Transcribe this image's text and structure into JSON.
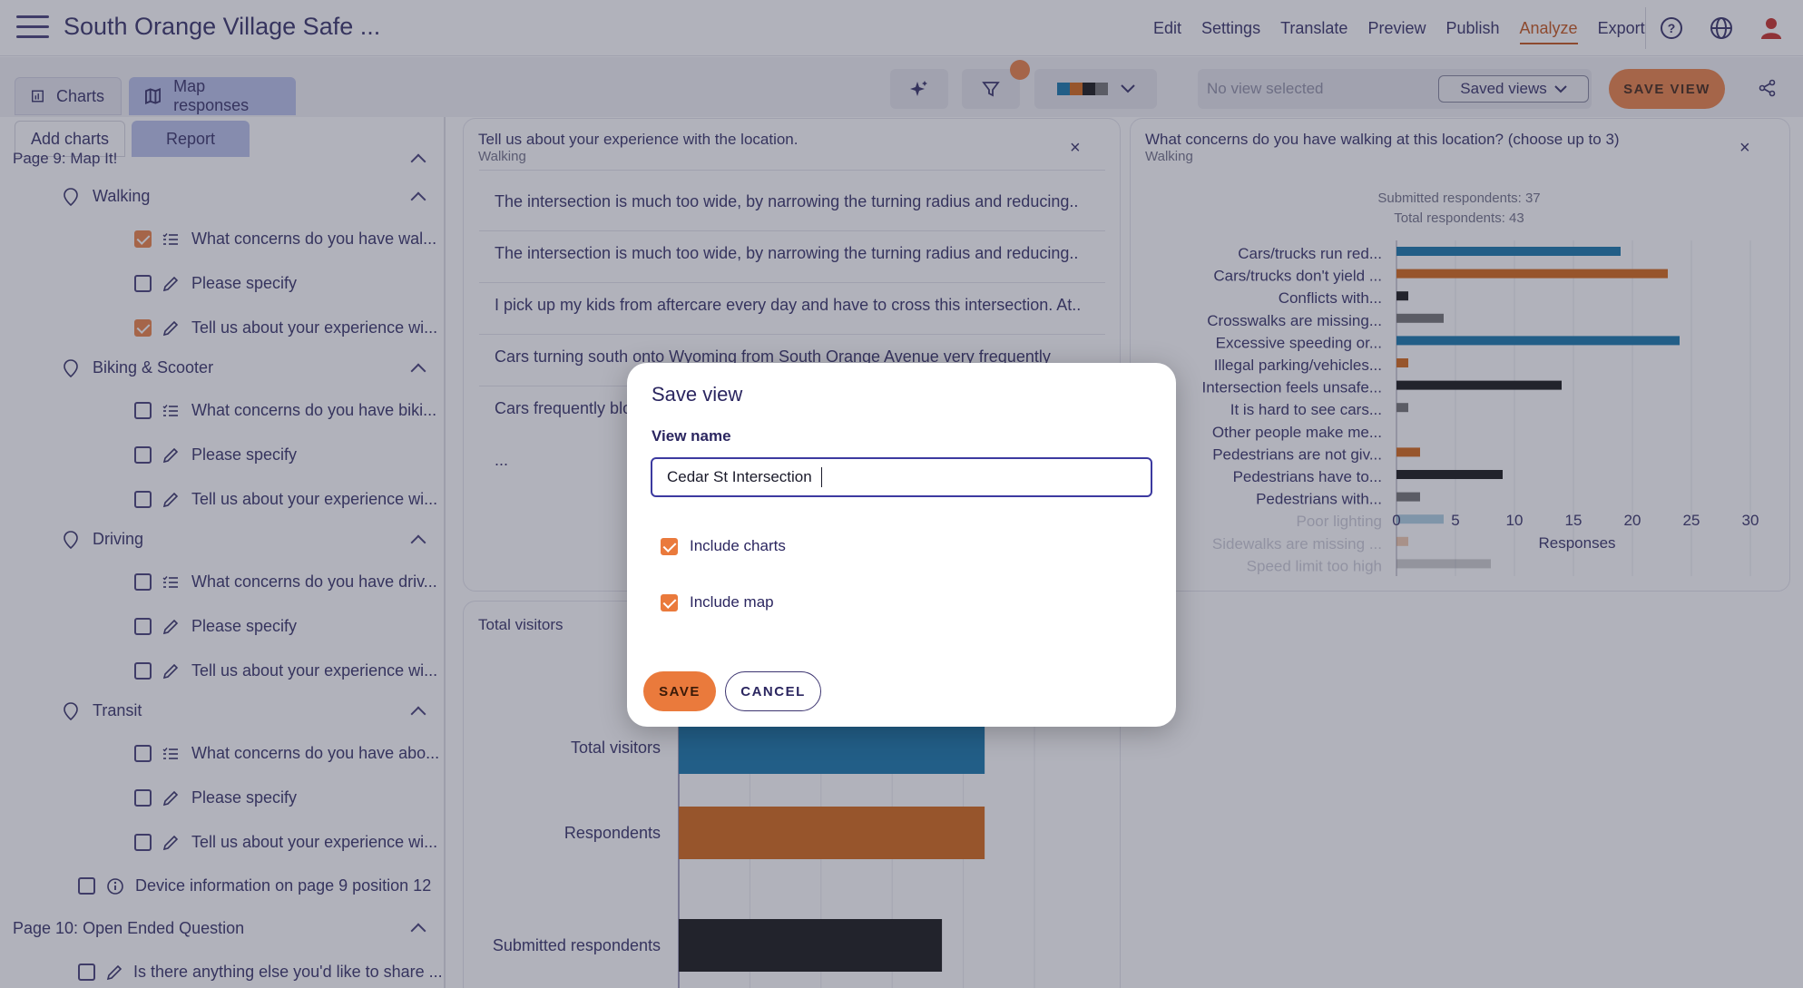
{
  "app": {
    "title": "South Orange Village Safe ..."
  },
  "nav": {
    "items": [
      "Edit",
      "Settings",
      "Translate",
      "Preview",
      "Publish",
      "Analyze",
      "Export"
    ],
    "active": "Analyze"
  },
  "tabs": {
    "charts": "Charts",
    "map": "Map responses"
  },
  "view": {
    "placeholder": "No view selected",
    "saved_views": "Saved views",
    "save_view": "SAVE VIEW"
  },
  "sidebar": {
    "tabs": {
      "add": "Add charts",
      "report": "Report"
    },
    "page9": "Page 9: Map It!",
    "groups": [
      {
        "name": "Walking",
        "items": [
          {
            "text": "What concerns do you have wal...",
            "checked": true,
            "icon": "list-icon"
          },
          {
            "text": "Please specify",
            "checked": false,
            "icon": "pencil-icon"
          },
          {
            "text": "Tell us about your experience wi...",
            "checked": true,
            "icon": "pencil-icon"
          }
        ]
      },
      {
        "name": "Biking & Scooter",
        "items": [
          {
            "text": "What concerns do you have biki...",
            "checked": false,
            "icon": "list-icon"
          },
          {
            "text": "Please specify",
            "checked": false,
            "icon": "pencil-icon"
          },
          {
            "text": "Tell us about your experience wi...",
            "checked": false,
            "icon": "pencil-icon"
          }
        ]
      },
      {
        "name": "Driving",
        "items": [
          {
            "text": "What concerns do you have driv...",
            "checked": false,
            "icon": "list-icon"
          },
          {
            "text": "Please specify",
            "checked": false,
            "icon": "pencil-icon"
          },
          {
            "text": "Tell us about your experience wi...",
            "checked": false,
            "icon": "pencil-icon"
          }
        ]
      },
      {
        "name": "Transit",
        "items": [
          {
            "text": "What concerns do you have abo...",
            "checked": false,
            "icon": "list-icon"
          },
          {
            "text": "Please specify",
            "checked": false,
            "icon": "pencil-icon"
          },
          {
            "text": "Tell us about your experience wi...",
            "checked": false,
            "icon": "pencil-icon"
          }
        ]
      }
    ],
    "device_info": "Device information on page 9 position 12",
    "page10": "Page 10: Open Ended Question",
    "page10_item": "Is there anything else you'd like to share ..."
  },
  "card1": {
    "title": "Tell us about your experience with the location.",
    "subtitle": "Walking",
    "responses": [
      "The intersection is much too wide, by narrowing the turning radius and reducing...",
      "The intersection is much too wide, by narrowing the turning radius and reducing...",
      "I pick up my kids from aftercare every day and have to cross this intersection. At...",
      "Cars turning south onto Wyoming from South Orange Avenue very frequently",
      "Cars frequently blo",
      "..."
    ]
  },
  "card2": {
    "title": "What concerns do you have walking at this location? (choose up to 3)",
    "subtitle": "Walking",
    "submitted": "Submitted respondents: 37",
    "total": "Total respondents: 43"
  },
  "card3": {
    "title": "Total visitors"
  },
  "modal": {
    "title": "Save view",
    "field_label": "View name",
    "field_value": "Cedar St Intersection",
    "include_charts": "Include charts",
    "include_map": "Include map",
    "save": "SAVE",
    "cancel": "CANCEL"
  },
  "colors": {
    "accent": "#ea7a3c",
    "blue": "#0a6fa6",
    "orange": "#d35f0a",
    "black": "#0a0a0a",
    "gray": "#6b6b6b"
  },
  "chart_data": [
    {
      "type": "bar",
      "title": "What concerns do you have walking at this location? (choose up to 3)",
      "orientation": "horizontal",
      "categories": [
        "Cars/trucks run red...",
        "Cars/trucks don't yield ...",
        "Conflicts with...",
        "Crosswalks are missing...",
        "Excessive speeding or...",
        "Illegal parking/vehicles...",
        "Intersection feels unsafe...",
        "It is hard to see cars...",
        "Other people make me...",
        "Pedestrians are not giv...",
        "Pedestrians have to...",
        "Pedestrians with...",
        "Poor lighting",
        "Sidewalks are missing ...",
        "Speed limit too high"
      ],
      "values": [
        19,
        23,
        1,
        4,
        24,
        1,
        14,
        1,
        0,
        2,
        9,
        2,
        4,
        1,
        8
      ],
      "colors": [
        "#0a6fa6",
        "#d35f0a",
        "#0a0a0a",
        "#6b6b6b",
        "#0a6fa6",
        "#d35f0a",
        "#0a0a0a",
        "#6b6b6b",
        "#0a6fa6",
        "#d35f0a",
        "#0a0a0a",
        "#6b6b6b",
        "#0a6fa6",
        "#d35f0a",
        "#6b6b6b"
      ],
      "faded_from_index": 12,
      "xlabel": "Responses",
      "xticks": [
        0,
        5,
        10,
        15,
        20,
        25,
        30
      ],
      "xlim": [
        0,
        30
      ]
    },
    {
      "type": "bar",
      "title": "Total visitors",
      "orientation": "horizontal",
      "categories": [
        "Total visitors",
        "Respondents",
        "Submitted respondents"
      ],
      "values": [
        43,
        43,
        37
      ],
      "colors": [
        "#0a6fa6",
        "#d35f0a",
        "#0a0a0a"
      ],
      "xlim": [
        0,
        50
      ]
    }
  ]
}
